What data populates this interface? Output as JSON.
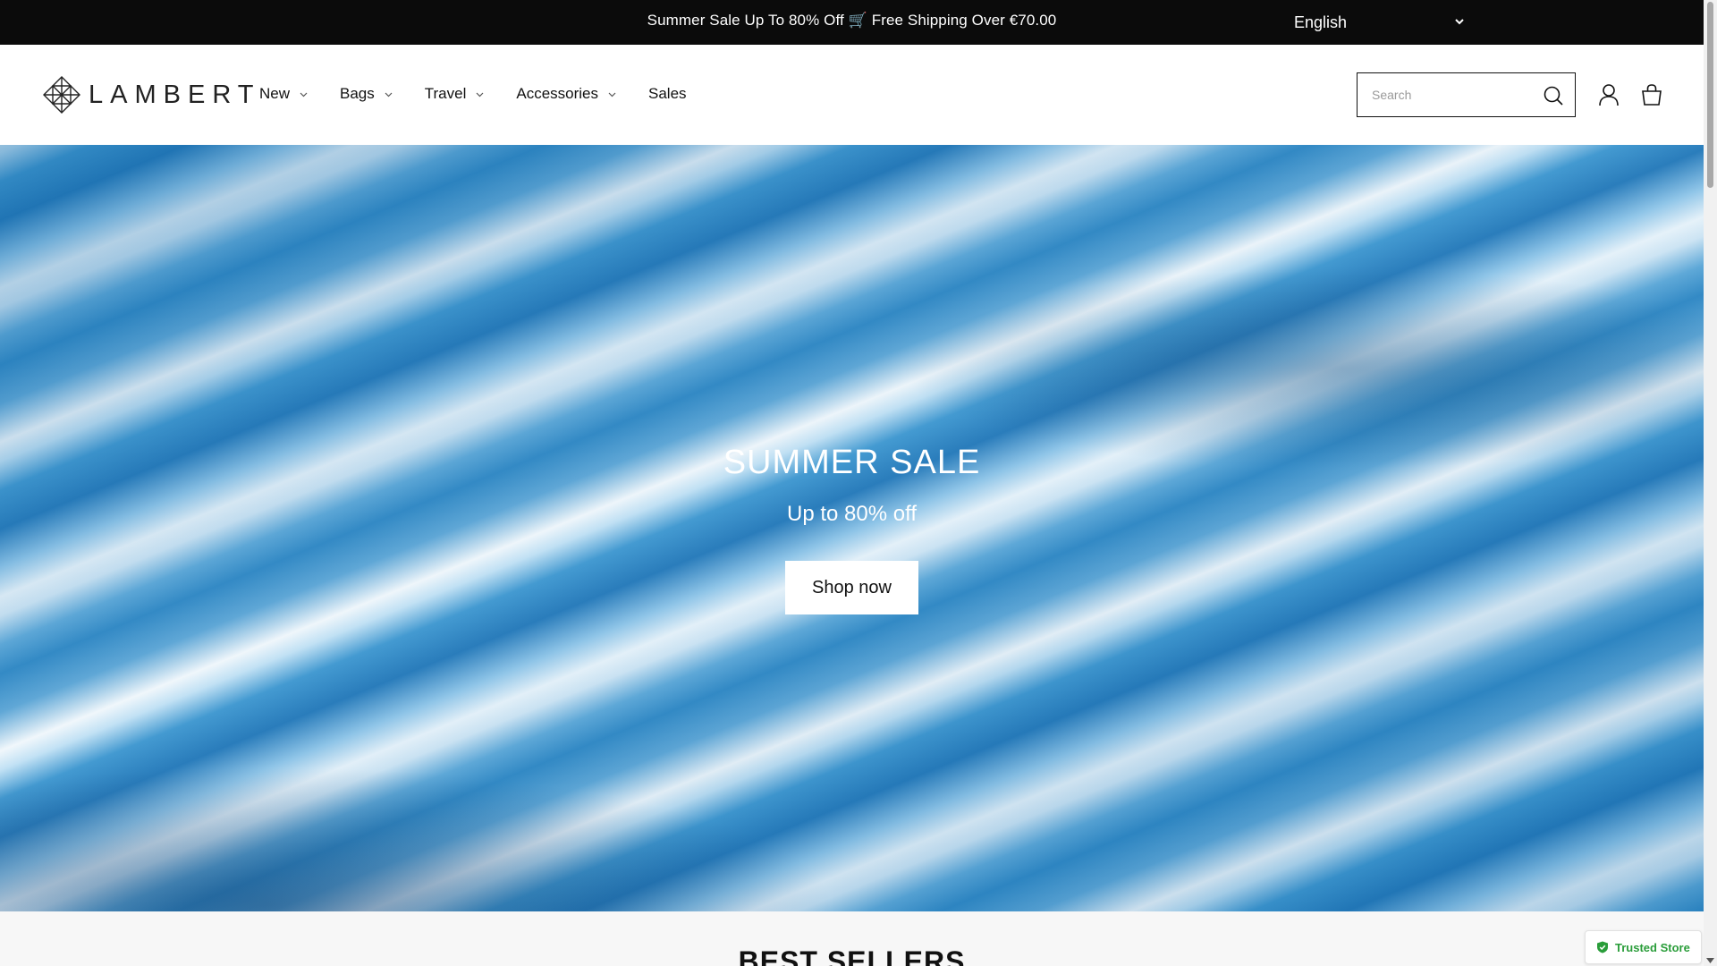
{
  "announcement": {
    "text": "Summer Sale Up To 80% Off 🛒 Free Shipping Over €70.00",
    "language": "English"
  },
  "header": {
    "logo_text": "LAMBERT",
    "nav": [
      {
        "label": "New",
        "has_dropdown": true
      },
      {
        "label": "Bags",
        "has_dropdown": true
      },
      {
        "label": "Travel",
        "has_dropdown": true
      },
      {
        "label": "Accessories",
        "has_dropdown": true
      },
      {
        "label": "Sales",
        "has_dropdown": false
      }
    ],
    "search": {
      "placeholder": "Search",
      "value": ""
    },
    "icons": [
      "search-icon",
      "account-icon",
      "cart-icon"
    ]
  },
  "hero": {
    "title": "SUMMER SALE",
    "subtitle": "Up to 80% off",
    "cta_label": "Shop now"
  },
  "section": {
    "title": "BEST SELLERS"
  },
  "trust_badge": {
    "label": "Trusted Store",
    "color": "#2a9d3a"
  },
  "colors": {
    "announcement_bg": "#0b0b0b",
    "hero_accent": "#2b86c4"
  }
}
